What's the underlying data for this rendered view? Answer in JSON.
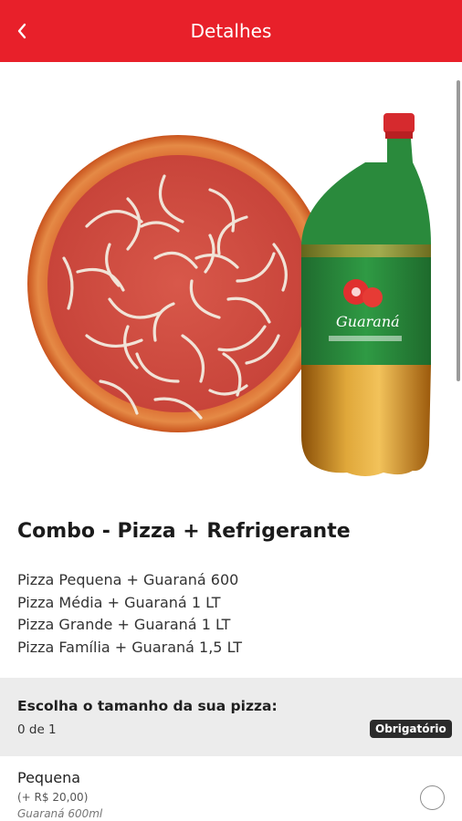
{
  "header": {
    "title": "Detalhes",
    "back_icon": "chevron-left-icon",
    "background": "#e8202a"
  },
  "product": {
    "image_alt": "Pizza de calabresa com cebola e garrafa de Guaraná",
    "name": "Combo - Pizza + Refrigerante",
    "description_lines": [
      "Pizza Pequena + Guaraná 600",
      "Pizza Média + Guaraná 1 LT",
      "Pizza Grande + Guaraná 1 LT",
      "Pizza Família + Guaraná 1,5 LT"
    ],
    "bottle_label": "Guaraná"
  },
  "choice_section": {
    "title": "Escolha o tamanho da sua pizza:",
    "count": "0 de 1",
    "badge": "Obrigatório"
  },
  "options": [
    {
      "name": "Pequena",
      "price": "(+ R$ 20,00)",
      "subtitle": "Guaraná 600ml",
      "selected": false
    }
  ]
}
